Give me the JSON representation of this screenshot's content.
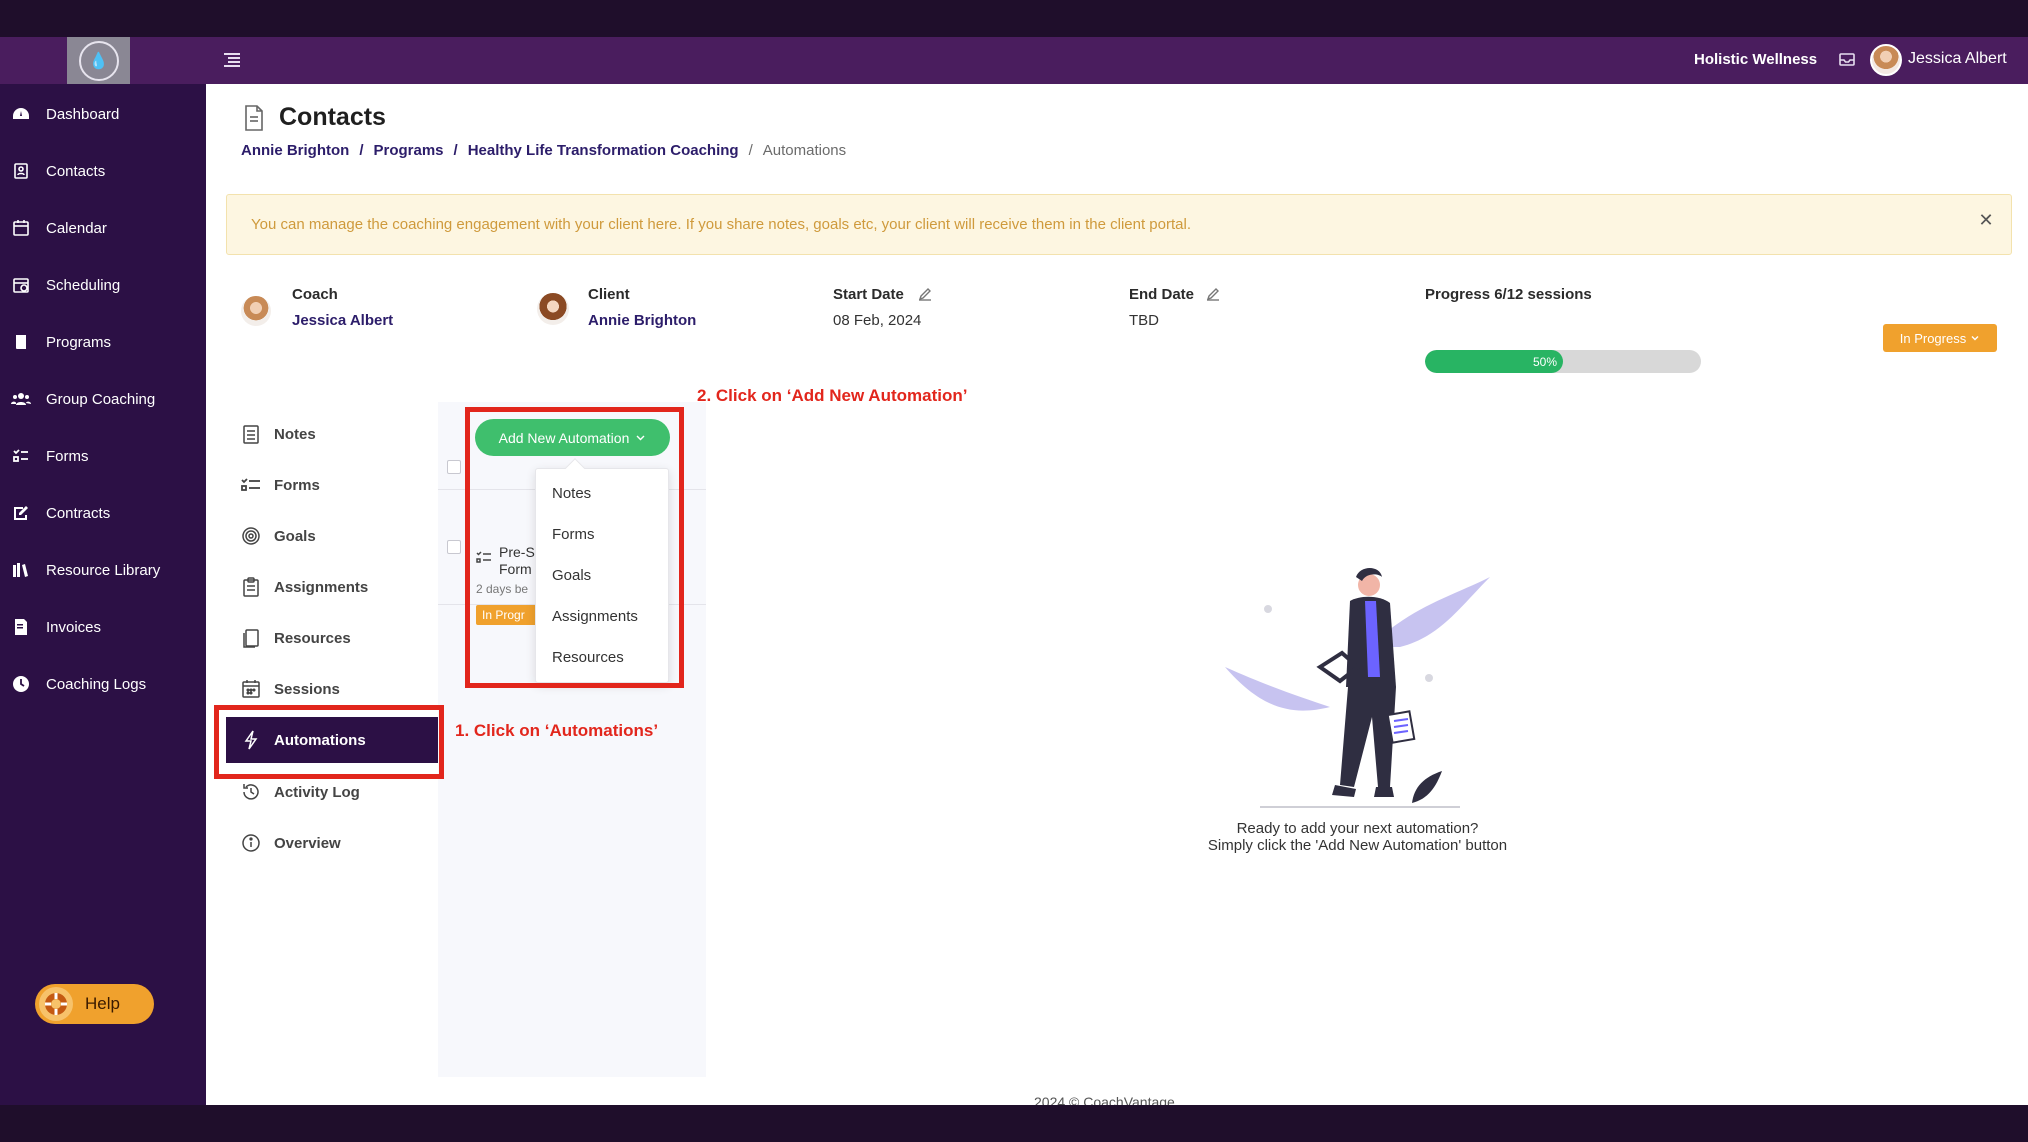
{
  "header": {
    "org_name": "Holistic Wellness",
    "user_name": "Jessica Albert"
  },
  "sidebar": {
    "items": [
      {
        "label": "Dashboard",
        "icon": "dashboard-icon"
      },
      {
        "label": "Contacts",
        "icon": "contacts-icon"
      },
      {
        "label": "Calendar",
        "icon": "calendar-icon"
      },
      {
        "label": "Scheduling",
        "icon": "scheduling-icon"
      },
      {
        "label": "Programs",
        "icon": "book-icon"
      },
      {
        "label": "Group Coaching",
        "icon": "group-icon"
      },
      {
        "label": "Forms",
        "icon": "forms-icon"
      },
      {
        "label": "Contracts",
        "icon": "contract-icon"
      },
      {
        "label": "Resource Library",
        "icon": "library-icon"
      },
      {
        "label": "Invoices",
        "icon": "invoice-icon"
      },
      {
        "label": "Coaching Logs",
        "icon": "clock-icon"
      }
    ],
    "help_label": "Help"
  },
  "page": {
    "title": "Contacts",
    "breadcrumb": [
      "Annie Brighton",
      "Programs",
      "Healthy Life Transformation Coaching",
      "Automations"
    ],
    "separator": "/",
    "banner": "You can manage the coaching engagement with your client here. If you share notes, goals etc, your client will receive them in the client portal.",
    "close_glyph": "✕"
  },
  "engagement": {
    "coach_label": "Coach",
    "coach_name": "Jessica Albert",
    "client_label": "Client",
    "client_name": "Annie Brighton",
    "start_label": "Start Date",
    "start_value": "08 Feb, 2024",
    "end_label": "End Date",
    "end_value": "TBD",
    "progress_label": "Progress 6/12 sessions",
    "progress_text": "50%",
    "progress_fraction": 0.5,
    "status": "In Progress"
  },
  "subnav": {
    "items": [
      {
        "label": "Notes",
        "icon": "notes-icon"
      },
      {
        "label": "Forms",
        "icon": "forms-list-icon"
      },
      {
        "label": "Goals",
        "icon": "target-icon"
      },
      {
        "label": "Assignments",
        "icon": "clipboard-icon"
      },
      {
        "label": "Resources",
        "icon": "resources-icon"
      },
      {
        "label": "Sessions",
        "icon": "sessions-calendar-icon"
      }
    ],
    "active": {
      "label": "Automations",
      "icon": "lightning-icon"
    },
    "after": [
      {
        "label": "Activity Log",
        "icon": "history-icon"
      },
      {
        "label": "Overview",
        "icon": "info-icon"
      }
    ]
  },
  "automations": {
    "add_button": "Add New Automation",
    "dropdown": [
      "Notes",
      "Forms",
      "Goals",
      "Assignments",
      "Resources"
    ],
    "item": {
      "title_line1": "Pre-S",
      "title_line2": "Form",
      "subtitle": "2 days be",
      "badge": "In Progr"
    },
    "empty_line1": "Ready to add your next automation?",
    "empty_line2": "Simply click the 'Add New Automation' button"
  },
  "annotations": {
    "step1": "1. Click on ‘Automations’",
    "step2": "2. Click on ‘Add New Automation’"
  },
  "footer": "2024 © CoachVantage",
  "colors": {
    "header": "#4a1d5e",
    "sidebar": "#2c1045",
    "accent_green": "#3fbf6d",
    "status_orange": "#f0a12d",
    "annotation_red": "#e2261c"
  }
}
